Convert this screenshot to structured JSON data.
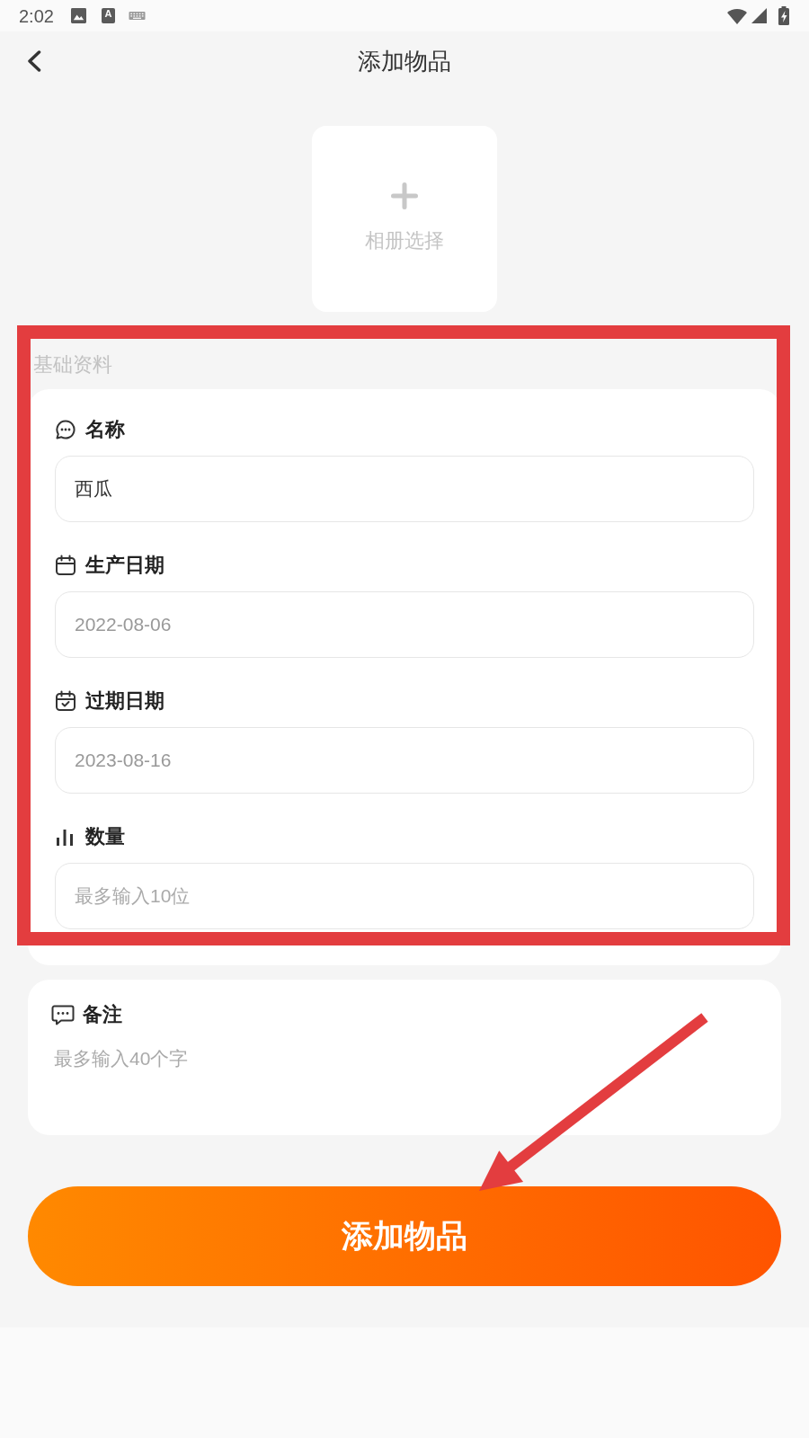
{
  "status_bar": {
    "time": "2:02",
    "input_method": "A"
  },
  "header": {
    "title": "添加物品"
  },
  "photo_picker": {
    "label": "相册选择"
  },
  "basic_info": {
    "title": "基础资料",
    "fields": [
      {
        "kind": "text",
        "label": "名称",
        "value": "西瓜"
      },
      {
        "kind": "date",
        "label": "生产日期",
        "value": "2022-08-06"
      },
      {
        "kind": "date",
        "label": "过期日期",
        "value": "2023-08-16"
      },
      {
        "kind": "number",
        "label": "数量",
        "placeholder": "最多输入10位"
      }
    ]
  },
  "notes": {
    "label": "备注",
    "placeholder": "最多输入40个字"
  },
  "submit_button": {
    "label": "添加物品"
  },
  "annotations": [
    {
      "kind": "frame"
    },
    {
      "kind": "arrow"
    }
  ]
}
